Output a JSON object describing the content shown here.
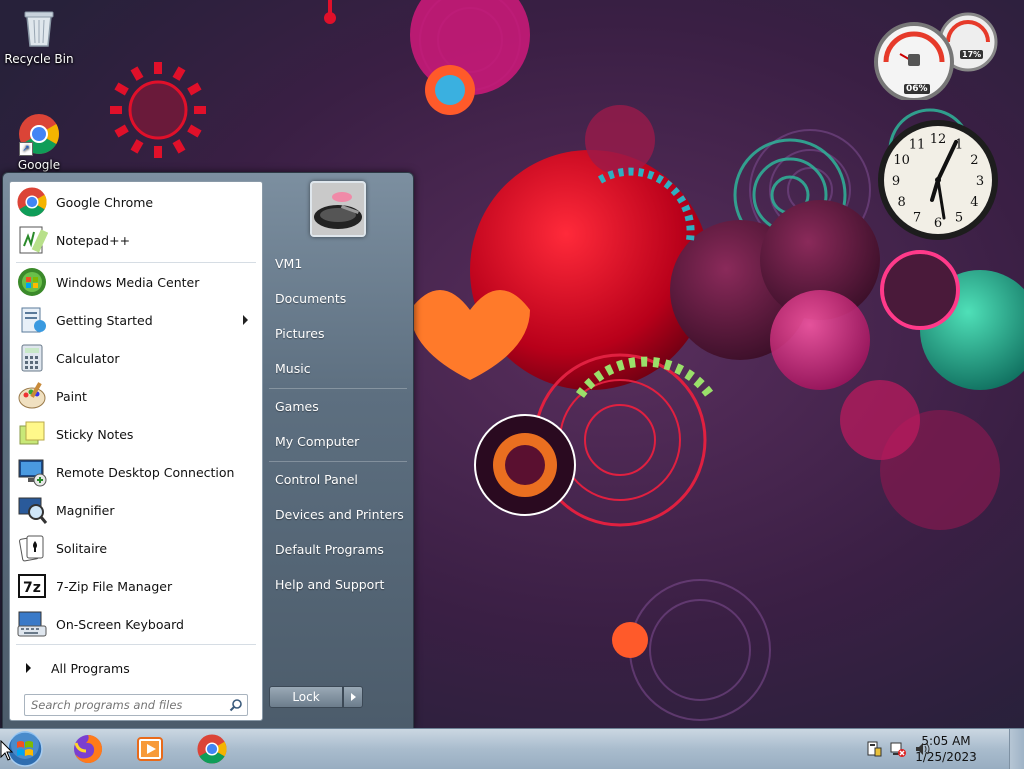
{
  "desktop": {
    "icons": [
      {
        "label": "Recycle Bin",
        "icon": "recycle-bin-icon"
      },
      {
        "label": "Google",
        "icon": "chrome-icon"
      }
    ]
  },
  "gadgets": {
    "cpu_meter": {
      "cpu": "06%",
      "memory": "17%"
    },
    "clock": {
      "numbers": [
        "12",
        "1",
        "2",
        "3",
        "4",
        "5",
        "6",
        "7",
        "8",
        "9",
        "10",
        "11"
      ]
    }
  },
  "start_menu": {
    "programs": [
      {
        "label": "Google Chrome",
        "icon": "chrome-icon"
      },
      {
        "label": "Notepad++",
        "icon": "notepadpp-icon"
      },
      {
        "label": "Windows Media Center",
        "icon": "media-center-icon"
      },
      {
        "label": "Getting Started",
        "icon": "getting-started-icon",
        "submenu": true
      },
      {
        "label": "Calculator",
        "icon": "calculator-icon"
      },
      {
        "label": "Paint",
        "icon": "paint-icon"
      },
      {
        "label": "Sticky Notes",
        "icon": "sticky-notes-icon"
      },
      {
        "label": "Remote Desktop Connection",
        "icon": "remote-desktop-icon"
      },
      {
        "label": "Magnifier",
        "icon": "magnifier-icon"
      },
      {
        "label": "Solitaire",
        "icon": "solitaire-icon"
      },
      {
        "label": "7-Zip File Manager",
        "icon": "7zip-icon",
        "glyph": "7z"
      },
      {
        "label": "On-Screen Keyboard",
        "icon": "keyboard-icon"
      }
    ],
    "all_programs": "All Programs",
    "search_placeholder": "Search programs and files",
    "right_links": [
      {
        "label": "VM1"
      },
      {
        "label": "Documents"
      },
      {
        "label": "Pictures"
      },
      {
        "label": "Music"
      },
      {
        "label": "Games"
      },
      {
        "label": "My Computer"
      },
      {
        "label": "Control Panel"
      },
      {
        "label": "Devices and Printers"
      },
      {
        "label": "Default Programs"
      },
      {
        "label": "Help and Support"
      }
    ],
    "lock_label": "Lock"
  },
  "taskbar": {
    "apps": [
      {
        "name": "start-orb",
        "icon": "windows-orb-icon"
      },
      {
        "name": "firefox",
        "icon": "firefox-icon"
      },
      {
        "name": "media-player",
        "icon": "media-player-icon"
      },
      {
        "name": "chrome",
        "icon": "chrome-icon"
      }
    ],
    "time": "5:05 AM",
    "date": "1/25/2023"
  },
  "colors": {
    "wallpaper_base": "#3b1d3f",
    "accent_red": "#e0102a",
    "accent_pink": "#e4307f",
    "accent_teal": "#2fb59a"
  }
}
